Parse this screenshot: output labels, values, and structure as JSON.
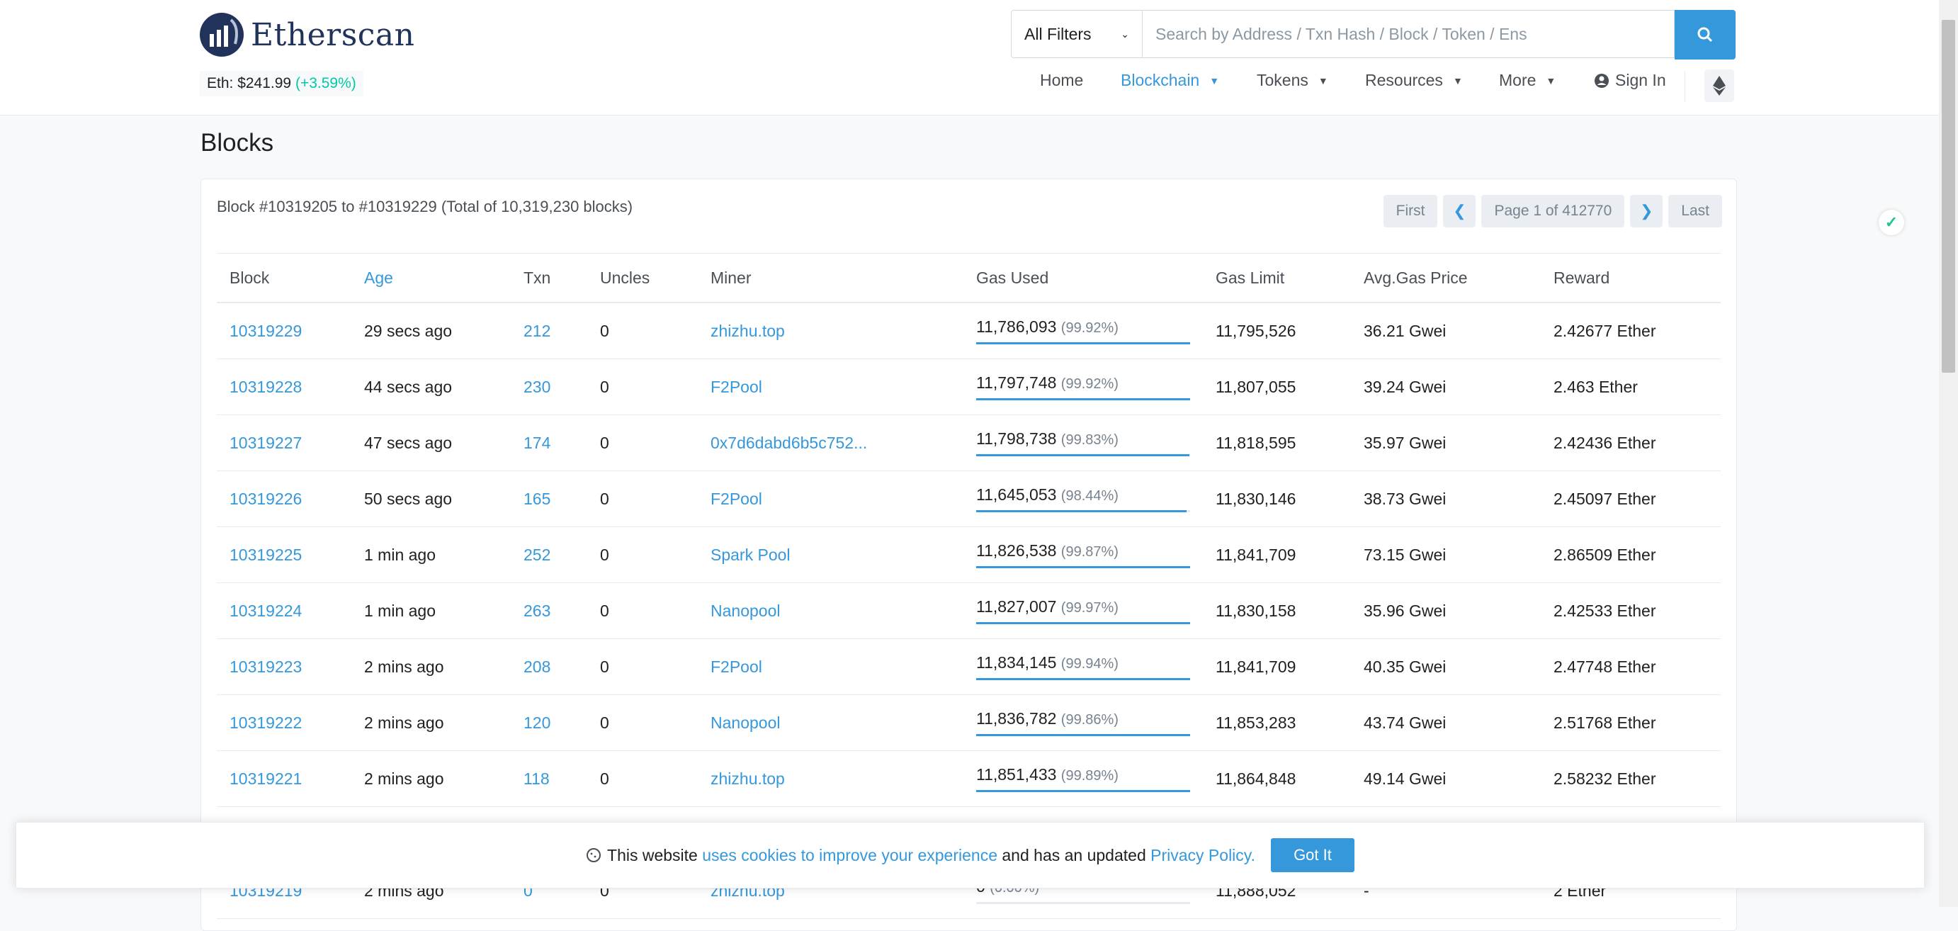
{
  "brand": {
    "name": "Etherscan"
  },
  "eth_price": {
    "label": "Eth: $241.99",
    "change": "(+3.59%)"
  },
  "search": {
    "filter": "All Filters",
    "placeholder": "Search by Address / Txn Hash / Block / Token / Ens"
  },
  "nav": {
    "home": "Home",
    "blockchain": "Blockchain",
    "tokens": "Tokens",
    "resources": "Resources",
    "more": "More",
    "signin": "Sign In"
  },
  "page": {
    "title": "Blocks",
    "summary": "Block #10319205 to #10319229 (Total of 10,319,230 blocks)"
  },
  "pager": {
    "first": "First",
    "info": "Page 1 of 412770",
    "last": "Last"
  },
  "table": {
    "headers": [
      "Block",
      "Age",
      "Txn",
      "Uncles",
      "Miner",
      "Gas Used",
      "Gas Limit",
      "Avg.Gas Price",
      "Reward"
    ],
    "rows": [
      {
        "block": "10319229",
        "age": "29 secs ago",
        "txn": "212",
        "uncles": "0",
        "miner": "zhizhu.top",
        "gas_used": "11,786,093",
        "gas_pct": "(99.92%)",
        "fill": 0.9992,
        "gas_limit": "11,795,526",
        "avg_price": "36.21 Gwei",
        "reward": "2.42677 Ether"
      },
      {
        "block": "10319228",
        "age": "44 secs ago",
        "txn": "230",
        "uncles": "0",
        "miner": "F2Pool",
        "gas_used": "11,797,748",
        "gas_pct": "(99.92%)",
        "fill": 0.9992,
        "gas_limit": "11,807,055",
        "avg_price": "39.24 Gwei",
        "reward": "2.463 Ether"
      },
      {
        "block": "10319227",
        "age": "47 secs ago",
        "txn": "174",
        "uncles": "0",
        "miner": "0x7d6dabd6b5c752...",
        "gas_used": "11,798,738",
        "gas_pct": "(99.83%)",
        "fill": 0.9983,
        "gas_limit": "11,818,595",
        "avg_price": "35.97 Gwei",
        "reward": "2.42436 Ether"
      },
      {
        "block": "10319226",
        "age": "50 secs ago",
        "txn": "165",
        "uncles": "0",
        "miner": "F2Pool",
        "gas_used": "11,645,053",
        "gas_pct": "(98.44%)",
        "fill": 0.9844,
        "gas_limit": "11,830,146",
        "avg_price": "38.73 Gwei",
        "reward": "2.45097 Ether"
      },
      {
        "block": "10319225",
        "age": "1 min ago",
        "txn": "252",
        "uncles": "0",
        "miner": "Spark Pool",
        "gas_used": "11,826,538",
        "gas_pct": "(99.87%)",
        "fill": 0.9987,
        "gas_limit": "11,841,709",
        "avg_price": "73.15 Gwei",
        "reward": "2.86509 Ether"
      },
      {
        "block": "10319224",
        "age": "1 min ago",
        "txn": "263",
        "uncles": "0",
        "miner": "Nanopool",
        "gas_used": "11,827,007",
        "gas_pct": "(99.97%)",
        "fill": 0.9997,
        "gas_limit": "11,830,158",
        "avg_price": "35.96 Gwei",
        "reward": "2.42533 Ether"
      },
      {
        "block": "10319223",
        "age": "2 mins ago",
        "txn": "208",
        "uncles": "0",
        "miner": "F2Pool",
        "gas_used": "11,834,145",
        "gas_pct": "(99.94%)",
        "fill": 0.9994,
        "gas_limit": "11,841,709",
        "avg_price": "40.35 Gwei",
        "reward": "2.47748 Ether"
      },
      {
        "block": "10319222",
        "age": "2 mins ago",
        "txn": "120",
        "uncles": "0",
        "miner": "Nanopool",
        "gas_used": "11,836,782",
        "gas_pct": "(99.86%)",
        "fill": 0.9986,
        "gas_limit": "11,853,283",
        "avg_price": "43.74 Gwei",
        "reward": "2.51768 Ether"
      },
      {
        "block": "10319221",
        "age": "2 mins ago",
        "txn": "118",
        "uncles": "0",
        "miner": "zhizhu.top",
        "gas_used": "11,851,433",
        "gas_pct": "(99.89%)",
        "fill": 0.9989,
        "gas_limit": "11,864,848",
        "avg_price": "49.14 Gwei",
        "reward": "2.58232 Ether"
      },
      {
        "block": "",
        "age": "",
        "txn": "",
        "uncles": "",
        "miner": "",
        "gas_used": "",
        "gas_pct": "",
        "fill": 0,
        "gas_limit": "",
        "avg_price": "",
        "reward": ""
      },
      {
        "block": "10319219",
        "age": "2 mins ago",
        "txn": "0",
        "uncles": "0",
        "miner": "zhizhu.top",
        "gas_used": "0",
        "gas_pct": "(0.00%)",
        "fill": 0,
        "gas_limit": "11,888,052",
        "avg_price": "-",
        "reward": "2 Ether"
      }
    ]
  },
  "cookie": {
    "pre": "This website",
    "link1": "uses cookies to improve your experience",
    "mid": "and has an updated",
    "link2": "Privacy Policy.",
    "button": "Got It"
  },
  "colors": {
    "accent": "#3498db",
    "brand_navy": "#21325b",
    "positive": "#00c9a7"
  }
}
